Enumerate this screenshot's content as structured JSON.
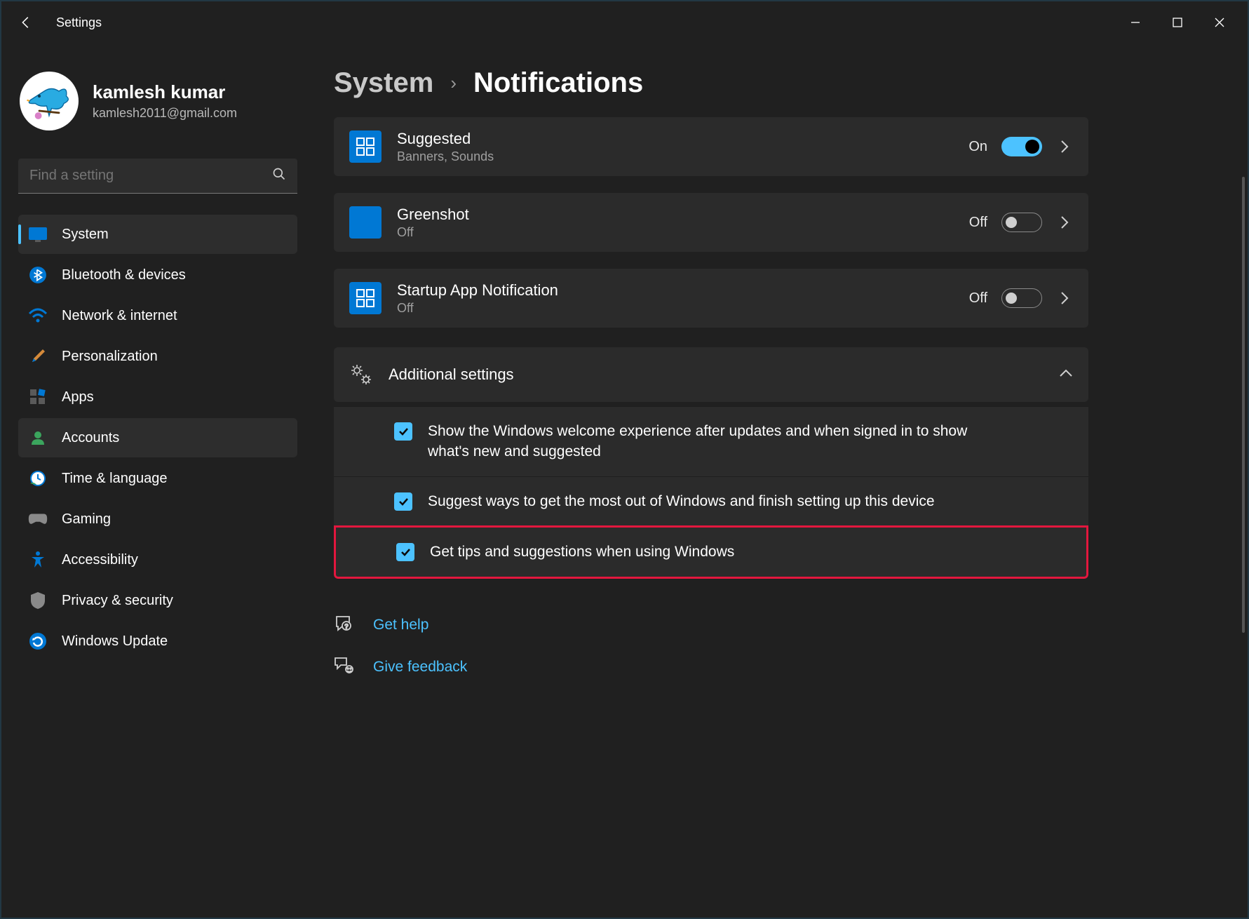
{
  "window": {
    "title": "Settings"
  },
  "user": {
    "name": "kamlesh kumar",
    "email": "kamlesh2011@gmail.com"
  },
  "search": {
    "placeholder": "Find a setting"
  },
  "sidebar": {
    "items": [
      {
        "label": "System"
      },
      {
        "label": "Bluetooth & devices"
      },
      {
        "label": "Network & internet"
      },
      {
        "label": "Personalization"
      },
      {
        "label": "Apps"
      },
      {
        "label": "Accounts"
      },
      {
        "label": "Time & language"
      },
      {
        "label": "Gaming"
      },
      {
        "label": "Accessibility"
      },
      {
        "label": "Privacy & security"
      },
      {
        "label": "Windows Update"
      }
    ]
  },
  "breadcrumb": {
    "parent": "System",
    "current": "Notifications"
  },
  "apps": [
    {
      "name": "Suggested",
      "sub": "Banners, Sounds",
      "state": "On",
      "on": true,
      "icon": "tiles"
    },
    {
      "name": "Greenshot",
      "sub": "Off",
      "state": "Off",
      "on": false,
      "icon": "square"
    },
    {
      "name": "Startup App Notification",
      "sub": "Off",
      "state": "Off",
      "on": false,
      "icon": "tiles"
    }
  ],
  "additional": {
    "title": "Additional settings"
  },
  "checkboxes": [
    {
      "text": "Show the Windows welcome experience after updates and when signed in to show what's new and suggested",
      "checked": true
    },
    {
      "text": "Suggest ways to get the most out of Windows and finish setting up this device",
      "checked": true
    },
    {
      "text": "Get tips and suggestions when using Windows",
      "checked": true
    }
  ],
  "help": {
    "get_help": "Get help",
    "feedback": "Give feedback"
  }
}
